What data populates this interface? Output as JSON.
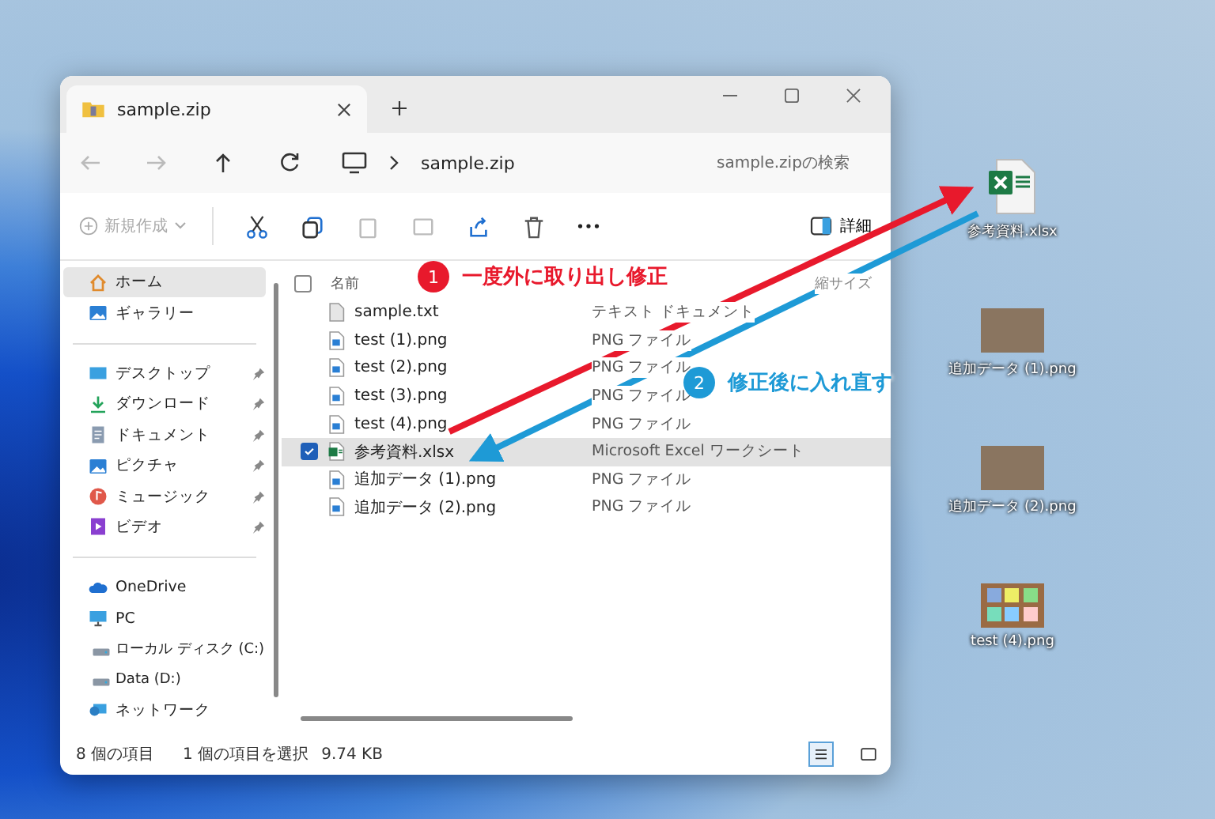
{
  "window": {
    "tab": {
      "title": "sample.zip"
    },
    "address": {
      "path": "sample.zip"
    },
    "search": {
      "placeholder": "sample.zipの検索"
    }
  },
  "toolbar": {
    "new_button": "新規作成",
    "details_button": "詳細"
  },
  "sidebar": {
    "groups": [
      [
        {
          "label": "ホーム",
          "kind": "home",
          "pinned": false,
          "selected": true
        },
        {
          "label": "ギャラリー",
          "kind": "gallery",
          "pinned": false,
          "selected": false
        }
      ],
      [
        {
          "label": "デスクトップ",
          "kind": "desktop",
          "pinned": true,
          "selected": false
        },
        {
          "label": "ダウンロード",
          "kind": "download",
          "pinned": true,
          "selected": false
        },
        {
          "label": "ドキュメント",
          "kind": "document",
          "pinned": true,
          "selected": false
        },
        {
          "label": "ピクチャ",
          "kind": "gallery",
          "pinned": true,
          "selected": false
        },
        {
          "label": "ミュージック",
          "kind": "music",
          "pinned": true,
          "selected": false
        },
        {
          "label": "ビデオ",
          "kind": "video",
          "pinned": true,
          "selected": false
        }
      ],
      [
        {
          "label": "OneDrive",
          "kind": "cloud",
          "pinned": false,
          "selected": false
        },
        {
          "label": "PC",
          "kind": "pc",
          "pinned": false,
          "selected": false,
          "children": [
            {
              "label": "ローカル ディスク (C:)",
              "kind": "drive",
              "selected": false
            },
            {
              "label": "Data (D:)",
              "kind": "drive",
              "selected": false
            }
          ]
        },
        {
          "label": "ネットワーク",
          "kind": "network",
          "pinned": false,
          "selected": false
        }
      ]
    ]
  },
  "file_list": {
    "columns": [
      "名前",
      "縮サイズ"
    ],
    "all_checked": false,
    "rows": [
      {
        "name": "sample.txt",
        "type": "テキスト ドキュメント",
        "kind": "text",
        "selected": false
      },
      {
        "name": "test (1).png",
        "type": "PNG ファイル",
        "kind": "image",
        "selected": false
      },
      {
        "name": "test (2).png",
        "type": "PNG ファイル",
        "kind": "image",
        "selected": false
      },
      {
        "name": "test (3).png",
        "type": "PNG ファイル",
        "kind": "image",
        "selected": false
      },
      {
        "name": "test (4).png",
        "type": "PNG ファイル",
        "kind": "image",
        "selected": false
      },
      {
        "name": "参考資料.xlsx",
        "type": "Microsoft Excel ワークシート",
        "kind": "excel",
        "selected": true
      },
      {
        "name": "追加データ (1).png",
        "type": "PNG ファイル",
        "kind": "image",
        "selected": false
      },
      {
        "name": "追加データ (2).png",
        "type": "PNG ファイル",
        "kind": "image",
        "selected": false
      }
    ]
  },
  "status_bar": {
    "item_count": "8 個の項目",
    "selection": "1 個の項目を選択",
    "size": "9.74 KB",
    "views": [
      {
        "kind": "details",
        "selected": true
      },
      {
        "kind": "tiles",
        "selected": false
      }
    ]
  },
  "desktop_icons": [
    {
      "label": "参考資料.xlsx",
      "kind": "excel"
    },
    {
      "label": "追加データ (1).png",
      "kind": "photo"
    },
    {
      "label": "追加データ (2).png",
      "kind": "photo"
    },
    {
      "label": "test (4).png",
      "kind": "board"
    }
  ],
  "annotations": [
    {
      "number": "1",
      "text": "一度外に取り出し修正",
      "color": "#e8192c"
    },
    {
      "number": "2",
      "text": "修正後に入れ直す",
      "color": "#1e9ad6"
    }
  ]
}
